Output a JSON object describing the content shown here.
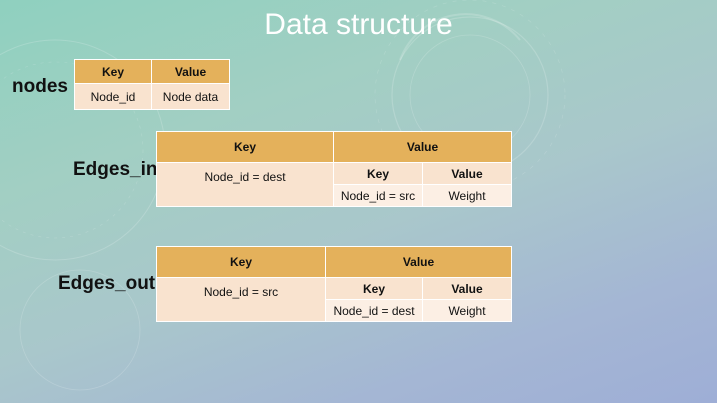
{
  "title": "Data structure",
  "nodes": {
    "label": "nodes",
    "headers": [
      "Key",
      "Value"
    ],
    "row": [
      "Node_id",
      "Node data"
    ]
  },
  "edges_in": {
    "label": "Edges_in",
    "header_key": "Key",
    "header_value": "Value",
    "key_cell": "Node_id = dest",
    "sub_headers": [
      "Key",
      "Value"
    ],
    "sub_row": [
      "Node_id = src",
      "Weight"
    ]
  },
  "edges_out": {
    "label": "Edges_out",
    "header_key": "Key",
    "header_value": "Value",
    "key_cell": "Node_id = src",
    "sub_headers": [
      "Key",
      "Value"
    ],
    "sub_row": [
      "Node_id = dest",
      "Weight"
    ]
  },
  "colors": {
    "header": "#e4b15b",
    "cell": "#f9e3cf",
    "title": "#ffffff"
  }
}
